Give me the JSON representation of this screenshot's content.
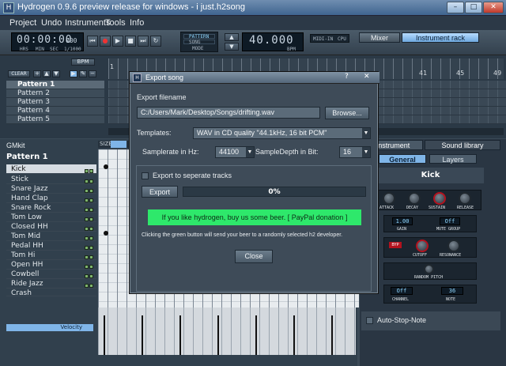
{
  "window": {
    "title": "Hydrogen 0.9.6 preview release for windows - i just.h2song",
    "controls": {
      "minimize": "–",
      "maximize": "□",
      "close": "✕"
    }
  },
  "menubar": {
    "items": [
      "Project",
      "Undo",
      "Instruments",
      "Tools",
      "Info"
    ]
  },
  "toolbar": {
    "time": "00:00:00",
    "time_ms": "000",
    "time_labels": [
      "HRS",
      "MIN",
      "SEC",
      "1/1000"
    ],
    "mode_labels": [
      "PATTERN",
      "SONG",
      "MODE"
    ],
    "bpm": "40.000",
    "bpm_label": "BPM",
    "midi_label": "MIDI-IN",
    "cpu_label": "CPU",
    "mixer_label": "Mixer",
    "instrument_rack_label": "Instrument rack"
  },
  "song_editor": {
    "bpm_btn": "BPM",
    "clear_btn": "CLEAR",
    "ruler": [
      "1",
      "41",
      "45",
      "49"
    ],
    "patterns": [
      "Pattern 1",
      "Pattern 2",
      "Pattern 3",
      "Pattern 4",
      "Pattern 5"
    ]
  },
  "pattern_editor": {
    "kit_name": "GMkit",
    "pattern_name": "Pattern 1",
    "size_label": "SIZE",
    "velocity_label": "Velocity",
    "instruments": [
      "Kick",
      "Stick",
      "Snare Jazz",
      "Hand Clap",
      "Snare Rock",
      "Tom Low",
      "Closed HH",
      "Tom Mid",
      "Pedal HH",
      "Tom Hi",
      "Open HH",
      "Cowbell",
      "Ride Jazz",
      "Crash"
    ]
  },
  "instrument_rack": {
    "tabs": [
      "Instrument",
      "Sound library"
    ],
    "subtabs": [
      "General",
      "Layers"
    ],
    "instrument_name": "Kick",
    "knob_labels": [
      "ATTACK",
      "DECAY",
      "SUSTAIN",
      "RELEASE"
    ],
    "gain_label": "GAIN",
    "mute_group_label": "MUTE GROUP",
    "gain_value": "1.00",
    "mute_value": "Off",
    "cutoff_label": "CUTOFF",
    "resonance_label": "RESONANCE",
    "byp_label": "BYP",
    "random_pitch_label": "RANDOM PITCH",
    "channel_label": "CHANNEL",
    "note_label": "NOTE",
    "channel_value": "Off",
    "note_value": "36",
    "auto_stop_label": "Auto-Stop-Note"
  },
  "dialog": {
    "title": "Export song",
    "help_btn": "?",
    "close_btn": "✕",
    "filename_label": "Export filename",
    "filename_value": "C:/Users/Mark/Desktop/Songs/drifting.wav",
    "browse_label": "Browse...",
    "templates_label": "Templates:",
    "template_value": "WAV in CD quality  \"44.1kHz, 16 bit PCM\"",
    "samplerate_label": "Samplerate in Hz:",
    "samplerate_value": "44100",
    "sampledepth_label": "SampleDepth in Bit:",
    "sampledepth_value": "16",
    "separate_tracks_label": "Export to seperate tracks",
    "export_label": "Export",
    "progress_text": "0%",
    "progress_value": 0,
    "beer_label": "If you like hydrogen, buy us some beer. [ PayPal donation ]",
    "beer_note": "Clicking the green button will send your beer to a randomly selected h2 developer.",
    "close_label": "Close"
  },
  "colors": {
    "accent_green": "#2ee86b",
    "selection_blue": "#7fb5e8",
    "knob_red": "#b3121e"
  }
}
